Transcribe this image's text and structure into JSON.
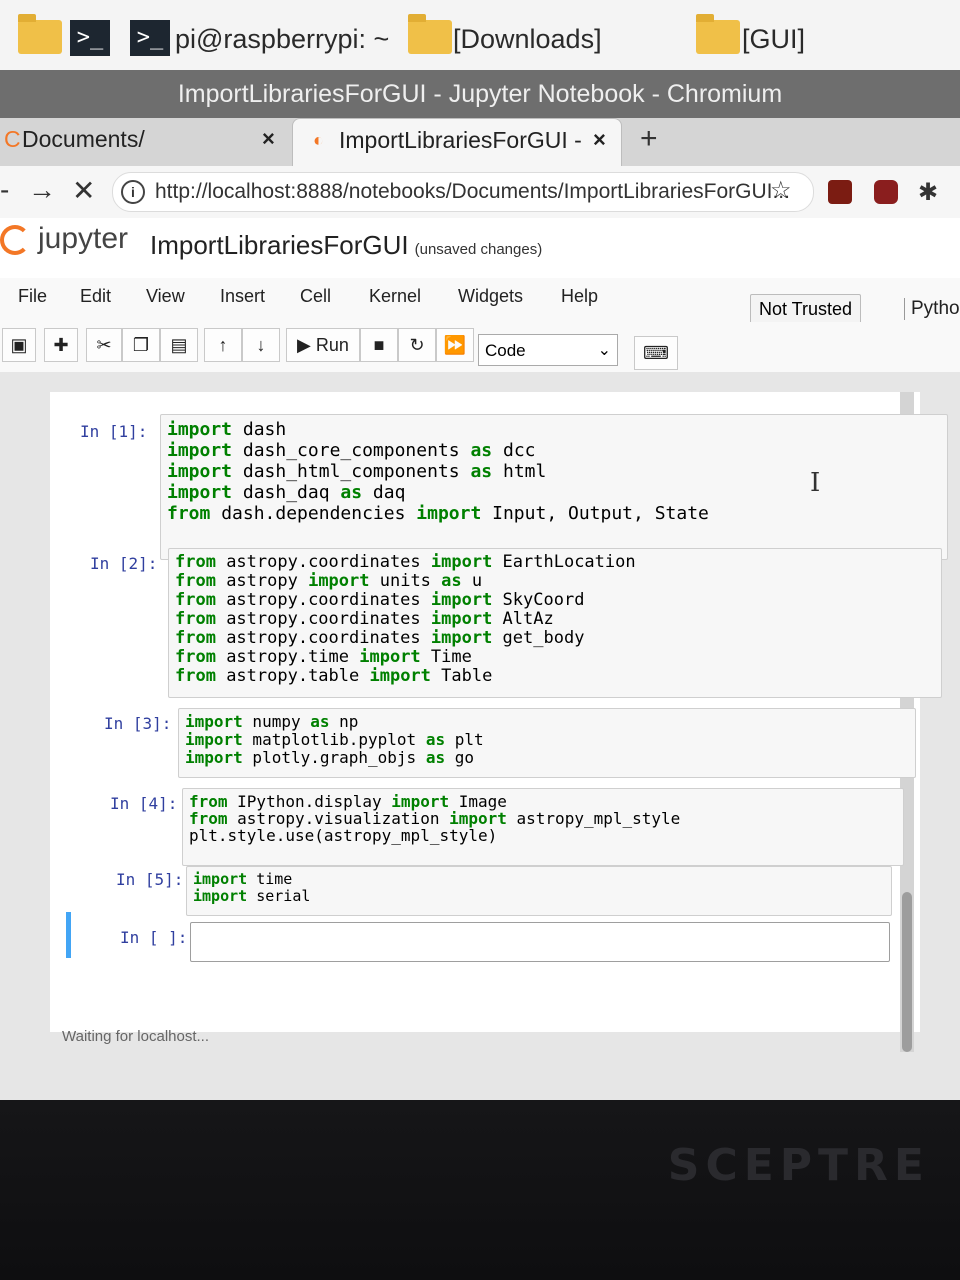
{
  "taskbar": {
    "terminal_label": "pi@raspberrypi: ~",
    "folder1_label": "[Downloads]",
    "folder2_label": "[GUI]"
  },
  "window": {
    "title": "ImportLibrariesForGUI - Jupyter Notebook - Chromium"
  },
  "tabs": [
    {
      "label": "Documents/",
      "active": false
    },
    {
      "label": "ImportLibrariesForGUI - ",
      "active": true
    }
  ],
  "address_bar": {
    "url": "http://localhost:8888/notebooks/Documents/ImportLibrariesForGUI..."
  },
  "jupyter": {
    "logo_text": "jupyter",
    "notebook_name": "ImportLibrariesForGUI",
    "save_status": "(unsaved changes)",
    "menus": [
      "File",
      "Edit",
      "View",
      "Insert",
      "Cell",
      "Kernel",
      "Widgets",
      "Help"
    ],
    "trust_label": "Not Trusted",
    "kernel_label": "Pytho",
    "run_label": "Run",
    "cell_type": "Code"
  },
  "cells": [
    {
      "prompt": "In [1]:",
      "lines": [
        [
          [
            "kw",
            "import"
          ],
          [
            "t",
            " dash"
          ]
        ],
        [
          [
            "kw",
            "import"
          ],
          [
            "t",
            " dash_core_components "
          ],
          [
            "kw",
            "as"
          ],
          [
            "t",
            " dcc"
          ]
        ],
        [
          [
            "kw",
            "import"
          ],
          [
            "t",
            " dash_html_components "
          ],
          [
            "kw",
            "as"
          ],
          [
            "t",
            " html"
          ]
        ],
        [
          [
            "kw",
            "import"
          ],
          [
            "t",
            " dash_daq "
          ],
          [
            "kw",
            "as"
          ],
          [
            "t",
            " daq"
          ]
        ],
        [
          [
            "kw",
            "from"
          ],
          [
            "t",
            " dash.dependencies "
          ],
          [
            "kw",
            "import"
          ],
          [
            "t",
            " Input, Output, State"
          ]
        ]
      ]
    },
    {
      "prompt": "In [2]:",
      "lines": [
        [
          [
            "kw",
            "from"
          ],
          [
            "t",
            " astropy.coordinates "
          ],
          [
            "kw",
            "import"
          ],
          [
            "t",
            " EarthLocation"
          ]
        ],
        [
          [
            "kw",
            "from"
          ],
          [
            "t",
            " astropy "
          ],
          [
            "kw",
            "import"
          ],
          [
            "t",
            " units "
          ],
          [
            "kw",
            "as"
          ],
          [
            "t",
            " u"
          ]
        ],
        [
          [
            "kw",
            "from"
          ],
          [
            "t",
            " astropy.coordinates "
          ],
          [
            "kw",
            "import"
          ],
          [
            "t",
            " SkyCoord"
          ]
        ],
        [
          [
            "kw",
            "from"
          ],
          [
            "t",
            " astropy.coordinates "
          ],
          [
            "kw",
            "import"
          ],
          [
            "t",
            " AltAz"
          ]
        ],
        [
          [
            "kw",
            "from"
          ],
          [
            "t",
            " astropy.coordinates "
          ],
          [
            "kw",
            "import"
          ],
          [
            "t",
            " get_body"
          ]
        ],
        [
          [
            "kw",
            "from"
          ],
          [
            "t",
            " astropy.time "
          ],
          [
            "kw",
            "import"
          ],
          [
            "t",
            " Time"
          ]
        ],
        [
          [
            "kw",
            "from"
          ],
          [
            "t",
            " astropy.table "
          ],
          [
            "kw",
            "import"
          ],
          [
            "t",
            " Table"
          ]
        ]
      ]
    },
    {
      "prompt": "In [3]:",
      "lines": [
        [
          [
            "kw",
            "import"
          ],
          [
            "t",
            " numpy "
          ],
          [
            "kw",
            "as"
          ],
          [
            "t",
            " np"
          ]
        ],
        [
          [
            "kw",
            "import"
          ],
          [
            "t",
            " matplotlib.pyplot "
          ],
          [
            "kw",
            "as"
          ],
          [
            "t",
            " plt"
          ]
        ],
        [
          [
            "kw",
            "import"
          ],
          [
            "t",
            " plotly.graph_objs "
          ],
          [
            "kw",
            "as"
          ],
          [
            "t",
            " go"
          ]
        ]
      ]
    },
    {
      "prompt": "In [4]:",
      "lines": [
        [
          [
            "kw",
            "from"
          ],
          [
            "t",
            " IPython.display "
          ],
          [
            "kw",
            "import"
          ],
          [
            "t",
            " Image"
          ]
        ],
        [
          [
            "kw",
            "from"
          ],
          [
            "t",
            " astropy.visualization "
          ],
          [
            "kw",
            "import"
          ],
          [
            "t",
            " astropy_mpl_style"
          ]
        ],
        [
          [
            "t",
            "plt.style.use(astropy_mpl_style)"
          ]
        ]
      ]
    },
    {
      "prompt": "In [5]:",
      "lines": [
        [
          [
            "kw",
            "import"
          ],
          [
            "t",
            " time"
          ]
        ],
        [
          [
            "kw",
            "import"
          ],
          [
            "t",
            " serial"
          ]
        ]
      ]
    },
    {
      "prompt": "In [ ]:",
      "lines": []
    }
  ],
  "status_bar": {
    "text": "Waiting for localhost..."
  },
  "colors": {
    "keyword": "#008000",
    "prompt": "#303f9f",
    "selected": "#42a5f5",
    "jupyter_orange": "#f37726"
  }
}
